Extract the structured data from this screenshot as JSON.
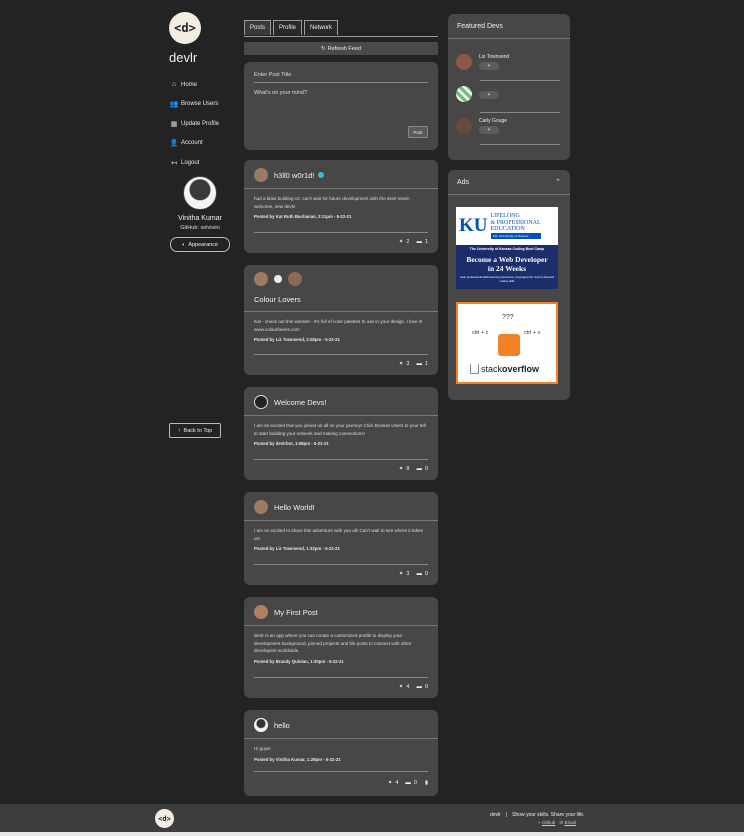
{
  "sidebar": {
    "logo_text": "<d>",
    "brand": "devlr",
    "nav": [
      {
        "label": "Home",
        "icon": "home-icon",
        "glyph": "⌂"
      },
      {
        "label": "Browse Users",
        "icon": "users-icon",
        "glyph": "👥"
      },
      {
        "label": "Update Profile",
        "icon": "dashboard-icon",
        "glyph": "▦"
      },
      {
        "label": "Account",
        "icon": "account-icon",
        "glyph": "👤"
      },
      {
        "label": "Logout",
        "icon": "logout-icon",
        "glyph": "↤"
      }
    ],
    "profile": {
      "name": "Vinitha Kumar",
      "github": "GitHub: selvivini",
      "appearance_label": "Appearance"
    },
    "back_to_top": "Back to Top"
  },
  "tabs": [
    "Posts",
    "Profile",
    "Network"
  ],
  "refresh_label": "Refresh Feed",
  "new_post": {
    "title_placeholder": "Enter Post Title",
    "body_placeholder": "What's on your mind?",
    "post_label": "Post"
  },
  "posts": [
    {
      "title": "h3ll0 w0r1d!",
      "body": "had a blast building v2, can't wait for future development with the devlr team! welcome, new devs!",
      "meta": "Posted by Kat Ruth Buchanan, 3:11pm - 5-22-21",
      "likes": "2",
      "comments": "1"
    },
    {
      "title": "Colour Lovers",
      "body": "Kat - check out this website - it's full of color palettes to use in your design. I love it! www.colourlovers.com",
      "meta": "Posted by Liz Townsend, 2:28pm - 5-22-21",
      "likes": "3",
      "comments": "1"
    },
    {
      "title": "Welcome Devs!",
      "body": "I am so excited that you joined us all on your journey! Click Browse Users to your left to start building your network and making connections!",
      "meta": "Posted by devlrbot, 1:58pm - 5-22-21",
      "likes": "8",
      "comments": "0"
    },
    {
      "title": "Hello World!",
      "body": "I am so excited to share this adventure with you all! Can't wait to see where it takes us!",
      "meta": "Posted by Liz Townsend, 1:32pm - 5-22-21",
      "likes": "3",
      "comments": "0"
    },
    {
      "title": "My First Post",
      "body": "devlr is an app where you can create a customized profile to display your development background, pinned projects and life posts to connect with other developers worldwide.",
      "meta": "Posted by Brandy Quinlan, 1:30pm - 5-22-21",
      "likes": "4",
      "comments": "0"
    },
    {
      "title": "hello",
      "body": "Hi guys!",
      "meta": "Posted by Vinitha Kumar, 1:29pm - 5-22-21",
      "likes": "4",
      "comments": "0"
    }
  ],
  "featured": {
    "title": "Featured Devs",
    "devs": [
      {
        "name": "Liz Townsend"
      },
      {
        "name": ""
      },
      {
        "name": "Carly Gouge"
      }
    ]
  },
  "ads": {
    "title": "Ads",
    "ku": {
      "logo": "KU",
      "line1": "LIFELONG",
      "line2": "& PROFESSIONAL",
      "line3": "EDUCATION",
      "line4": "The University of Kansas",
      "tag": "The University of Kansas Coding Boot Camp",
      "headline1": "Become a Web Developer",
      "headline2": "in 24 Weeks",
      "sub": "Gain professional skills learning experience, leveraging the most in-demand coding skills"
    },
    "so": {
      "q": "???",
      "left": "ctrl + c",
      "right": "ctrl + v",
      "brand1": "stack",
      "brand2": "overflow"
    }
  },
  "footer": {
    "logo": "<d>",
    "brand": "devlr",
    "tagline": "Show your skills. Share your life.",
    "github": "Github",
    "email": "Email"
  }
}
